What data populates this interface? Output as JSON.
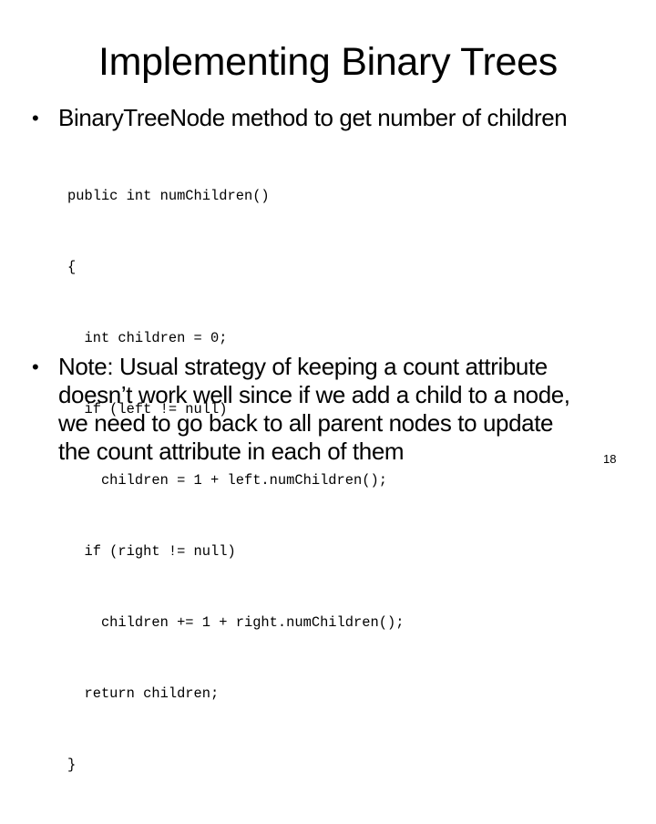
{
  "slide": {
    "title": "Implementing Binary Trees",
    "bullets": [
      {
        "marker": "•",
        "lines": [
          "BinaryTreeNode method to get number of children"
        ]
      },
      {
        "marker": "•",
        "lines": [
          "Note: Usual strategy of keeping a count attribute",
          "doesn’t work well since if we add a child to a node,",
          "we need to go back to all parent nodes to update",
          "the count attribute in each of them"
        ]
      }
    ],
    "code": [
      "public int numChildren()",
      "{",
      "  int children = 0;",
      "  if (left != null)",
      "    children = 1 + left.numChildren();",
      "  if (right != null)",
      "    children += 1 + right.numChildren();",
      "  return children;",
      "}"
    ],
    "slide_number": "18"
  }
}
